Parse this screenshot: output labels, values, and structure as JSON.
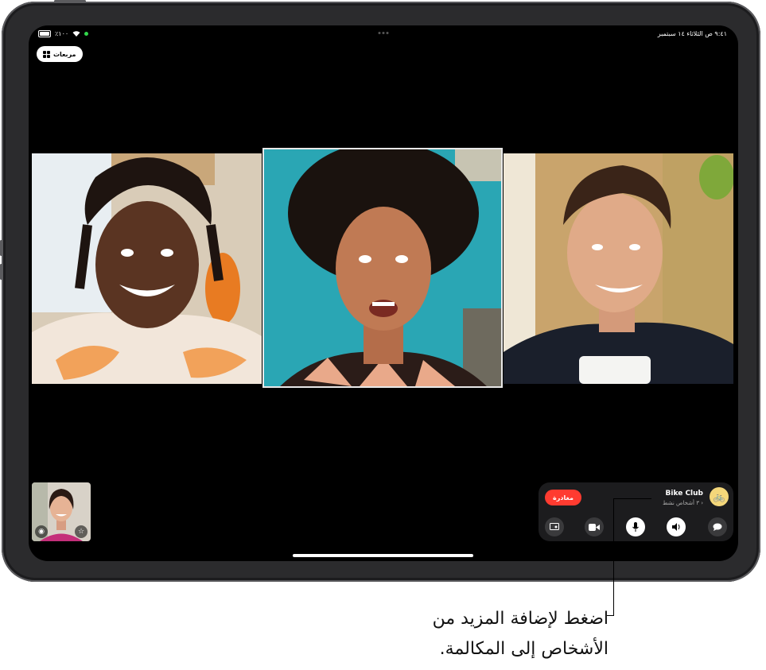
{
  "status_bar": {
    "time_date": "٩:٤١ ص الثلاثاء ١٤ سبتمبر",
    "battery_text": "٪١٠٠"
  },
  "grid_button": {
    "label": "مربعات"
  },
  "participants": [
    {
      "name": "participant-left",
      "active": false
    },
    {
      "name": "participant-center",
      "active": true
    },
    {
      "name": "participant-right",
      "active": false
    }
  ],
  "controls": {
    "leave_label": "مغادرة",
    "group_name": "Bike Club",
    "group_subtitle": "٣ أشخاص نشط",
    "group_avatar_icon": "bicycle-icon",
    "buttons": [
      "share-screen-icon",
      "video-camera-icon",
      "microphone-icon",
      "speaker-icon",
      "message-icon"
    ]
  },
  "callout": {
    "line1": "اضغط لإضافة المزيد من",
    "line2": "الأشخاص إلى المكالمة."
  },
  "colors": {
    "leave": "#ff3b30",
    "screen_bg": "#000000",
    "control_panel": "#1c1c1e"
  }
}
